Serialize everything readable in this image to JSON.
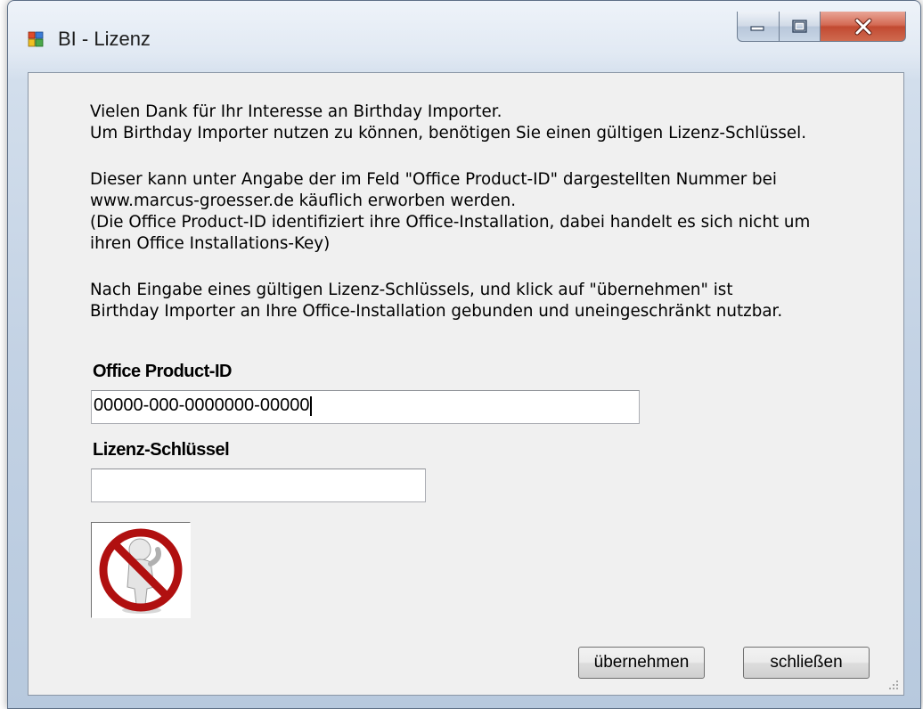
{
  "window": {
    "title": "BI - Lizenz",
    "icon": "app-window-icon",
    "controls": [
      "minimize-icon",
      "maximize-icon",
      "close-icon"
    ]
  },
  "intro": {
    "lines": [
      "Vielen Dank für Ihr Interesse an Birthday Importer.",
      "Um Birthday Importer nutzen zu können, benötigen Sie einen gültigen Lizenz-Schlüssel."
    ]
  },
  "info": {
    "lines": [
      "Dieser kann unter Angabe der im Feld \"Office Product-ID\" dargestellten Nummer bei",
      "www.marcus-groesser.de käuflich erworben werden.",
      "(Die Office Product-ID identifiziert ihre Office-Installation, dabei handelt es sich nicht um",
      "ihren Office Installations-Key)"
    ]
  },
  "note": {
    "lines": [
      "Nach Eingabe eines gültigen Lizenz-Schlüssels, und klick auf \"übernehmen\" ist",
      "Birthday Importer an Ihre Office-Installation gebunden und uneingeschränkt nutzbar."
    ]
  },
  "product_id": {
    "label": "Office Product-ID",
    "value": "00000-000-0000000-00000"
  },
  "license_key": {
    "label": "Lizenz-Schlüssel",
    "value": ""
  },
  "status_image": "not-licensed-icon",
  "buttons": {
    "apply": "übernehmen",
    "close": "schließen"
  },
  "colors": {
    "dialog_bg": "#f0f0f0",
    "close_button": "#c24a32",
    "prohibition_red": "#b01010"
  }
}
